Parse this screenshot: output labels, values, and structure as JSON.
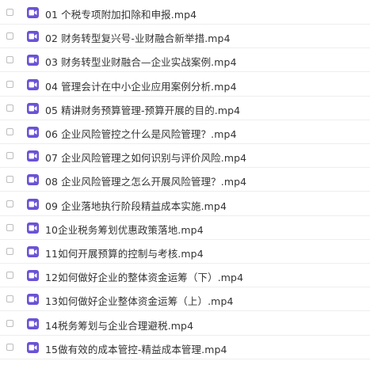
{
  "colors": {
    "video_icon": "#6b52d6",
    "text": "#333333"
  },
  "icons": {
    "row_icon": "video-file-icon",
    "checkbox": "checkbox-icon"
  },
  "files": [
    {
      "name": "01 个税专项附加扣除和申报.mp4"
    },
    {
      "name": "02 财务转型复兴号-业财融合新举措.mp4"
    },
    {
      "name": "03 财务转型业财融合—企业实战案例.mp4"
    },
    {
      "name": "04 管理会计在中小企业应用案例分析.mp4"
    },
    {
      "name": "05 精讲财务预算管理-预算开展的目的.mp4"
    },
    {
      "name": "06 企业风险管控之什么是风险管理？.mp4"
    },
    {
      "name": "07 企业风险管理之如何识别与评价风险.mp4"
    },
    {
      "name": "08 企业风险管理之怎么开展风险管理？.mp4"
    },
    {
      "name": "09 企业落地执行阶段精益成本实施.mp4"
    },
    {
      "name": "10企业税务筹划优惠政策落地.mp4"
    },
    {
      "name": "11如何开展预算的控制与考核.mp4"
    },
    {
      "name": "12如何做好企业的整体资金运筹（下）.mp4"
    },
    {
      "name": "13如何做好企业整体资金运筹（上）.mp4"
    },
    {
      "name": "14税务筹划与企业合理避税.mp4"
    },
    {
      "name": "15做有效的成本管控-精益成本管理.mp4"
    }
  ]
}
